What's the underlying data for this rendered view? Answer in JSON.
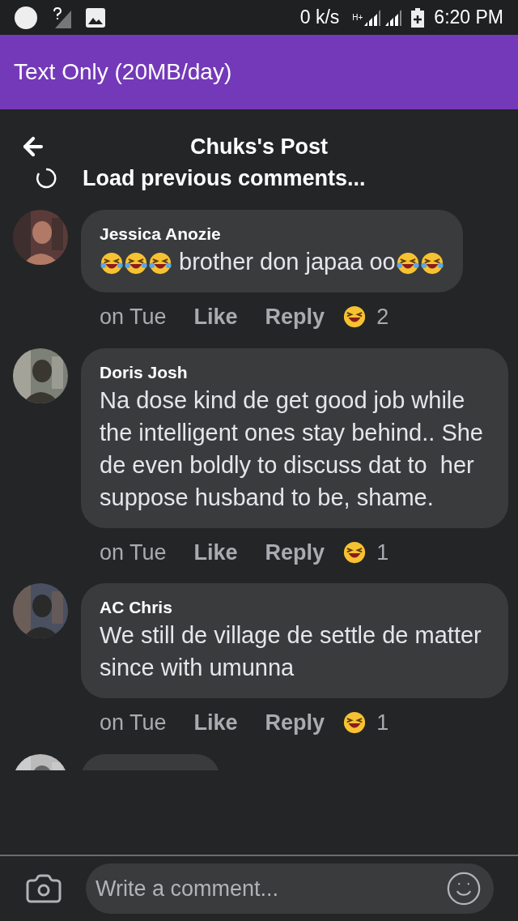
{
  "status_bar": {
    "speed": "0 k/s",
    "network": "H+",
    "time": "6:20 PM"
  },
  "banner": {
    "title": "Text Only (20MB/day)"
  },
  "header": {
    "title": "Chuks's Post"
  },
  "load_more": {
    "label": "Load previous comments..."
  },
  "comments": [
    {
      "kind": "full",
      "name": "Jessica Anozie",
      "body": [
        {
          "kind": "emoji"
        },
        {
          "kind": "emoji"
        },
        {
          "kind": "emoji"
        },
        {
          "kind": "text",
          "text": " brother don japaa oo"
        },
        {
          "kind": "emoji"
        },
        {
          "kind": "emoji"
        }
      ],
      "time": "on Tue",
      "like": "Like",
      "reply": "Reply",
      "reactions": "2"
    },
    {
      "kind": "full",
      "name": "Doris Josh",
      "body": [
        {
          "kind": "text",
          "text": "Na dose kind de get good job while the intelligent ones stay behind.. She de even boldly to discuss dat to  her suppose husband to be, shame."
        }
      ],
      "time": "on Tue",
      "like": "Like",
      "reply": "Reply",
      "reactions": "1"
    },
    {
      "kind": "full",
      "name": "AC Chris",
      "body": [
        {
          "kind": "text",
          "text": "We still de village de settle de matter since with umunna"
        }
      ],
      "time": "on Tue",
      "like": "Like",
      "reply": "Reply",
      "reactions": "1"
    },
    {
      "kind": "partial"
    }
  ],
  "composer": {
    "placeholder": "Write a comment..."
  }
}
